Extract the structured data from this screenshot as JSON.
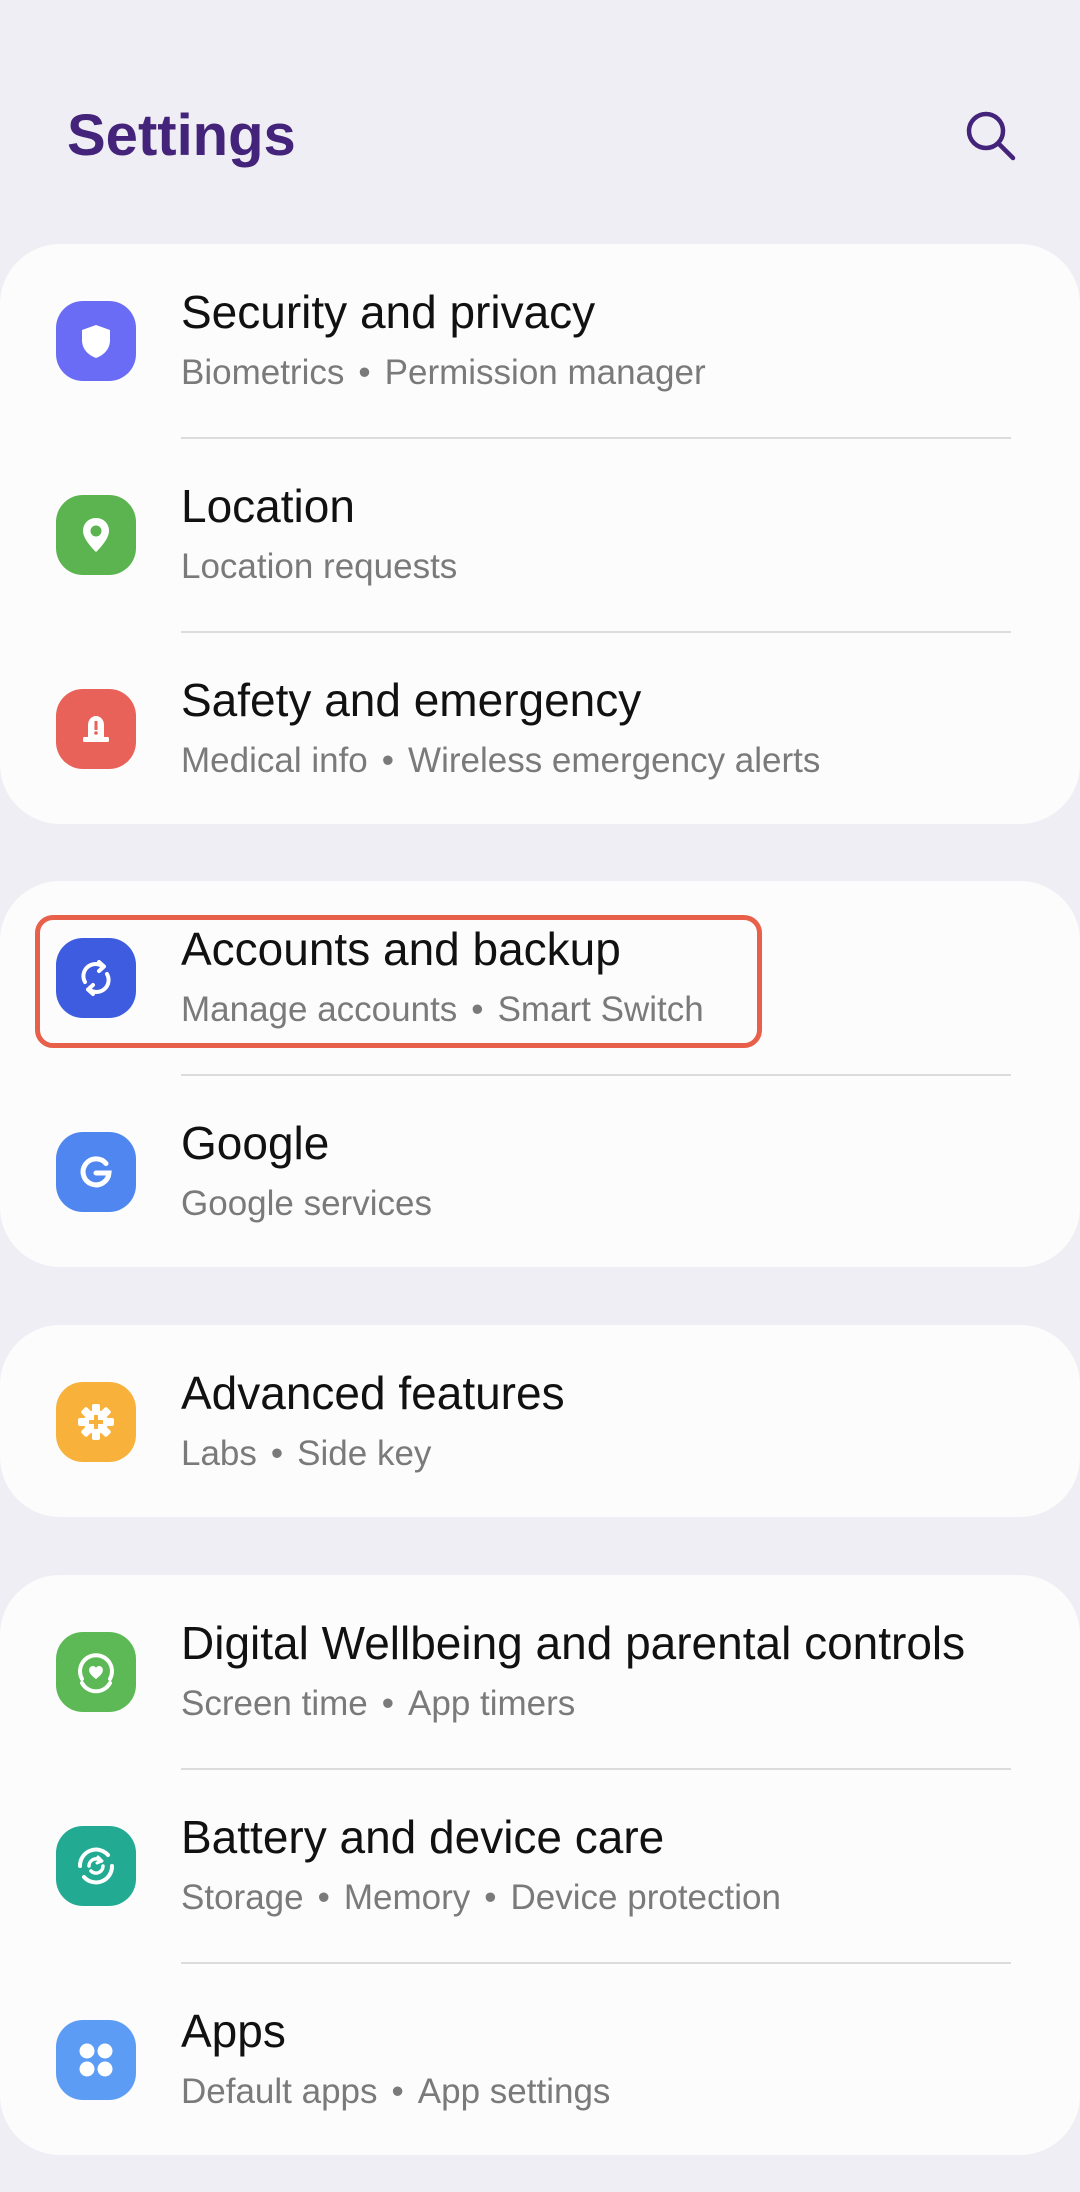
{
  "header": {
    "title": "Settings",
    "search_icon": "search-icon"
  },
  "colors": {
    "title": "#44237a",
    "background": "#efeef4",
    "card": "#fcfcfc",
    "highlight": "#e8604a"
  },
  "groups": [
    {
      "items": [
        {
          "title": "Security and privacy",
          "sub": [
            "Biometrics",
            "Permission manager"
          ],
          "icon": "shield-icon",
          "color": "#6b6cf6"
        },
        {
          "title": "Location",
          "sub": [
            "Location requests"
          ],
          "icon": "location-pin-icon",
          "color": "#5bb450"
        },
        {
          "title": "Safety and emergency",
          "sub": [
            "Medical info",
            "Wireless emergency alerts"
          ],
          "icon": "emergency-light-icon",
          "color": "#e8625a"
        }
      ]
    },
    {
      "items": [
        {
          "title": "Accounts and backup",
          "sub": [
            "Manage accounts",
            "Smart Switch"
          ],
          "icon": "sync-icon",
          "color": "#3d5ce0"
        },
        {
          "title": "Google",
          "sub": [
            "Google services"
          ],
          "icon": "google-icon",
          "color": "#4f86f0"
        }
      ]
    },
    {
      "items": [
        {
          "title": "Advanced features",
          "sub": [
            "Labs",
            "Side key"
          ],
          "icon": "gear-plus-icon",
          "color": "#f8b23c"
        }
      ]
    },
    {
      "items": [
        {
          "title": "Digital Wellbeing and parental controls",
          "sub": [
            "Screen time",
            "App timers"
          ],
          "icon": "wellbeing-heart-icon",
          "color": "#5db955"
        },
        {
          "title": "Battery and device care",
          "sub": [
            "Storage",
            "Memory",
            "Device protection"
          ],
          "icon": "device-care-icon",
          "color": "#22aa92"
        },
        {
          "title": "Apps",
          "sub": [
            "Default apps",
            "App settings"
          ],
          "icon": "apps-grid-icon",
          "color": "#5d9cf5"
        }
      ]
    }
  ]
}
